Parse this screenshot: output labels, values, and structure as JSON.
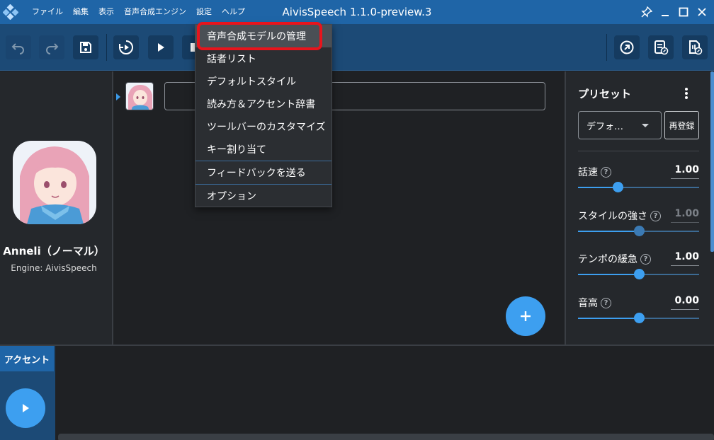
{
  "window": {
    "title": "AivisSpeech 1.1.0-preview.3",
    "accent_color": "#1f65a7"
  },
  "menubar": {
    "items": [
      "ファイル",
      "編集",
      "表示",
      "音声合成エンジン",
      "設定",
      "ヘルプ"
    ]
  },
  "toolbar": {
    "left_icons": [
      "undo-icon",
      "redo-icon",
      "save-icon",
      "play-all-icon",
      "play-icon",
      "stop-icon"
    ],
    "right_icons": [
      "export-icon",
      "export-text-icon",
      "export-audio-icon"
    ]
  },
  "character": {
    "name": "Anneli（ノーマル）",
    "engine": "Engine: AivisSpeech"
  },
  "editor": {
    "text_value": ""
  },
  "settings_menu": {
    "items": [
      "音声合成モデルの管理",
      "話者リスト",
      "デフォルトスタイル",
      "読み方＆アクセント辞書",
      "ツールバーのカスタマイズ",
      "キー割り当て",
      "フィードバックを送る",
      "オプション"
    ],
    "highlighted_index": 0,
    "highlight_color": "#e8141c"
  },
  "preset": {
    "title": "プリセット",
    "selected": "デフォ…",
    "reregister_label": "再登録",
    "params": [
      {
        "label": "話速",
        "value": "1.00",
        "fraction": 0.33,
        "enabled": true
      },
      {
        "label": "スタイルの強さ",
        "value": "1.00",
        "fraction": 0.5,
        "enabled": false
      },
      {
        "label": "テンポの緩急",
        "value": "1.00",
        "fraction": 0.5,
        "enabled": true
      },
      {
        "label": "音高",
        "value": "0.00",
        "fraction": 0.5,
        "enabled": true
      }
    ]
  },
  "bottom": {
    "tab_label": "アクセント"
  }
}
